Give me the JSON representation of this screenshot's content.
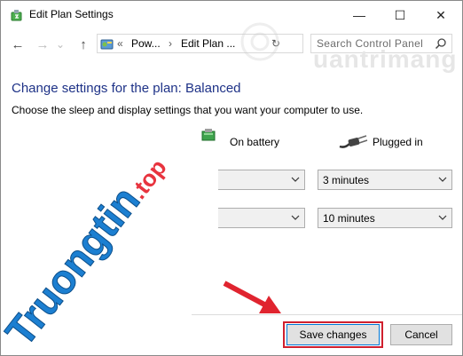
{
  "window": {
    "title": "Edit Plan Settings",
    "controls": {
      "minimize": "—",
      "maximize": "☐",
      "close": "✕"
    }
  },
  "nav": {
    "back": "←",
    "forward": "→",
    "recent": "⌄",
    "up": "↑",
    "breadcrumb_prefix": "«",
    "breadcrumb": [
      "Pow...",
      "Edit Plan ..."
    ],
    "separator": "›",
    "refresh": "↻",
    "search_placeholder": "Search Control Panel"
  },
  "watermark": {
    "text": "uantrimang"
  },
  "main": {
    "heading": "Change settings for the plan: Balanced",
    "subtext": "Choose the sleep and display settings that you want your computer to use.",
    "columns": {
      "battery": "On battery",
      "plugged": "Plugged in"
    },
    "rows": [
      {
        "battery_value": "",
        "plugged_value": "3 minutes"
      },
      {
        "battery_value": "",
        "plugged_value": "10 minutes"
      }
    ]
  },
  "footer": {
    "save_label": "Save changes",
    "cancel_label": "Cancel"
  },
  "overlay": {
    "brand": "Truongtin",
    "brand_suffix": ".top"
  },
  "colors": {
    "heading": "#1e3287",
    "highlight": "#d0202e",
    "brand_blue": "#1c7fd1",
    "brand_red": "#e8343f"
  }
}
